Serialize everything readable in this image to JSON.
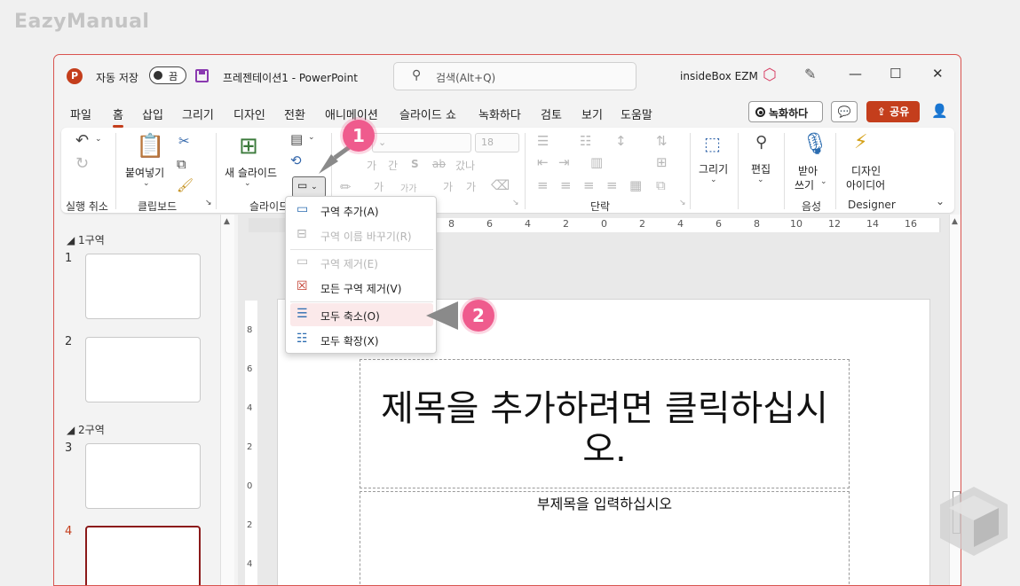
{
  "watermark": "EazyManual",
  "titlebar": {
    "app_icon": "P",
    "autosave_label": "자동 저장",
    "autosave_state": "끔",
    "doc_title": "프레젠테이션1  -  PowerPoint",
    "search_placeholder": "검색(Alt+Q)",
    "user_name": "insideBox EZM",
    "minimize": "—",
    "maximize": "☐",
    "close": "✕"
  },
  "menu": {
    "tabs": [
      "파일",
      "홈",
      "삽입",
      "그리기",
      "디자인",
      "전환",
      "애니메이션",
      "슬라이드 쇼",
      "녹화하다",
      "검토",
      "보기",
      "도움말"
    ],
    "active_index": 1,
    "record_button": "녹화하다",
    "share_button": "공유",
    "share_icon": "⇪",
    "comment_icon": "💬",
    "person_icon": "👤"
  },
  "ribbon": {
    "undo_label": "실행 취소",
    "paste_label": "붙여넣기",
    "clipboard_label": "클립보드",
    "new_slide_label": "새 슬라이드",
    "slides_group_label": "슬라이드",
    "font_size": "18",
    "paragraph_label": "단락",
    "draw_label": "그리기",
    "edit_label": "편집",
    "dictate_label_1": "받아",
    "dictate_label_2": "쓰기",
    "voice_label": "음성",
    "designer_label_1": "디자인",
    "designer_label_2": "아이디어",
    "designer_group_label": "Designer",
    "font_glyphs": [
      "가",
      "간",
      "S",
      "ab",
      "갔나"
    ],
    "font_glyphs_row2": [
      "가",
      "가가",
      "가",
      "가"
    ]
  },
  "section_menu": {
    "items": [
      {
        "label": "구역 추가(A)",
        "icon": "▭",
        "enabled": true
      },
      {
        "label": "구역 이름 바꾸기(R)",
        "icon": "⊟",
        "enabled": false
      },
      {
        "label": "구역 제거(E)",
        "icon": "▭",
        "enabled": false
      },
      {
        "label": "모든 구역 제거(V)",
        "icon": "☒",
        "enabled": true
      },
      {
        "label": "모두 축소(O)",
        "icon": "☰",
        "enabled": true
      },
      {
        "label": "모두 확장(X)",
        "icon": "☷",
        "enabled": true
      }
    ]
  },
  "slide_pane": {
    "sections": [
      "1구역",
      "2구역"
    ],
    "slide_numbers": [
      "1",
      "2",
      "3",
      "4"
    ],
    "active_slide": "4"
  },
  "ruler": {
    "h_ticks": [
      "8",
      "6",
      "4",
      "2",
      "0",
      "2",
      "4",
      "6",
      "8",
      "10",
      "12",
      "14",
      "16"
    ],
    "v_ticks": [
      "8",
      "6",
      "4",
      "2",
      "0",
      "2",
      "4"
    ]
  },
  "slide": {
    "title_placeholder": "제목을 추가하려면 클릭하십시오.",
    "subtitle_placeholder": "부제목을 입력하십시오"
  },
  "annotations": {
    "badge_1": "1",
    "badge_2": "2"
  },
  "colors": {
    "accent": "#c43e1c",
    "badge": "#ef5b8d",
    "hover": "#fbe9ea"
  }
}
